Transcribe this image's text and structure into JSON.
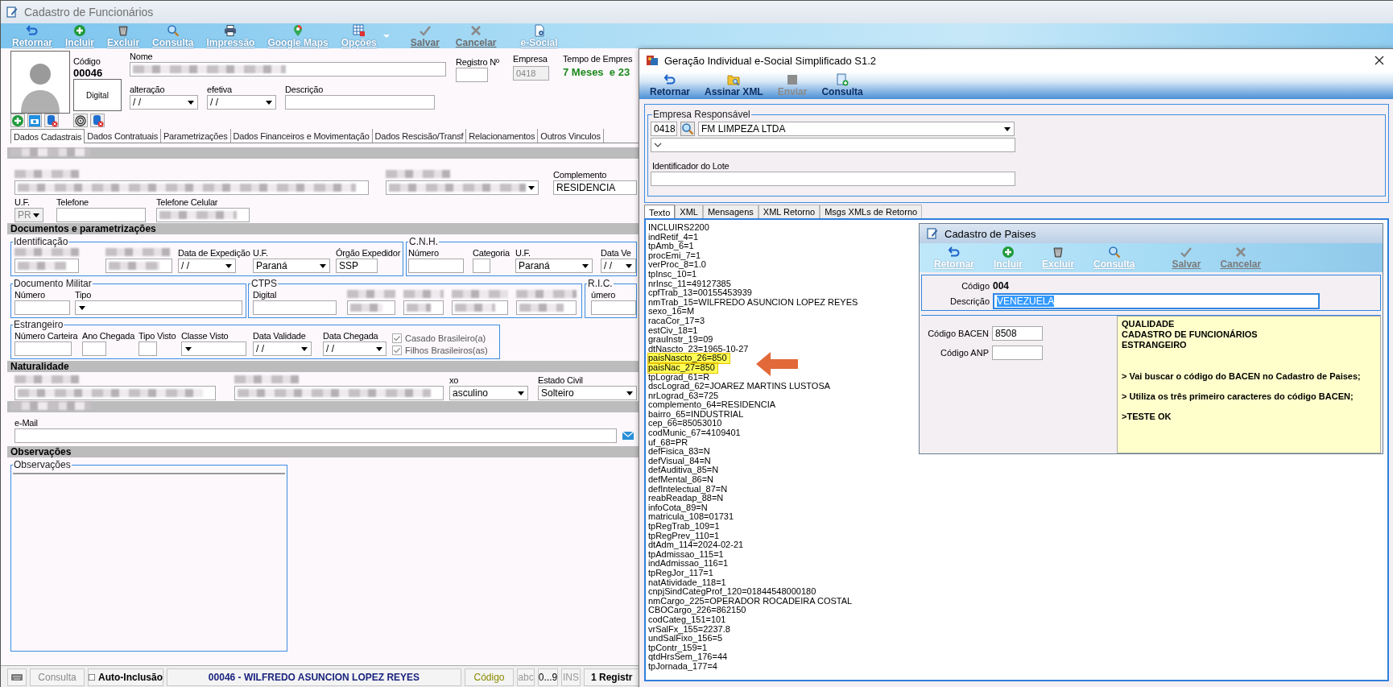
{
  "main_window": {
    "title": "Cadastro de Funcionários",
    "toolbar": [
      {
        "label": "Retornar",
        "disabled": false
      },
      {
        "label": "Incluir",
        "disabled": false
      },
      {
        "label": "Excluir",
        "disabled": false
      },
      {
        "label": "Consulta",
        "disabled": false
      },
      {
        "label": "Impressão",
        "disabled": false
      },
      {
        "label": "Google Maps",
        "disabled": false
      },
      {
        "label": "Opções",
        "disabled": false
      },
      {
        "label": "Salvar",
        "disabled": true
      },
      {
        "label": "Cancelar",
        "disabled": true
      },
      {
        "label": "e-Social",
        "disabled": false
      }
    ],
    "header": {
      "codigo_label": "Código",
      "codigo": "00046",
      "digital": "Digital",
      "nome_label": "Nome",
      "registro_label": "Registro Nº",
      "empresa_label": "Empresa",
      "empresa": "0418",
      "empresa_disabled": true,
      "tempo_label": "Tempo de Empres",
      "tempo": "7 Meses  e 23",
      "alteracao_label": "alteração",
      "alteracao": "/ /",
      "efetiva_label": "efetiva",
      "efetiva": "/ /",
      "descricao_label": "Descrição"
    },
    "tabs": [
      {
        "label": "Dados Cadastrais",
        "selected": true
      },
      {
        "label": "Dados Contratuais",
        "selected": false
      },
      {
        "label": "Parametrizações",
        "selected": false
      },
      {
        "label": "Dados Financeiros e Movimentação",
        "selected": false
      },
      {
        "label": "Dados Rescisão/Transf",
        "selected": false
      },
      {
        "label": "Relacionamentos",
        "selected": false
      },
      {
        "label": "Outros Vinculos",
        "selected": false
      }
    ],
    "blocks": [
      {
        "kind": "band"
      },
      {
        "kind": "row",
        "fields": [
          {
            "kind": "text",
            "redacted": true
          },
          {
            "kind": "combo",
            "redacted": true
          },
          {
            "kind": "text",
            "label": "Complemento",
            "value": "RESIDENCIA"
          }
        ]
      },
      {
        "kind": "row",
        "fields": [
          {
            "kind": "combo",
            "label": "U.F.",
            "value": "PR",
            "disabled": true
          },
          {
            "kind": "text",
            "label": "Telefone"
          },
          {
            "kind": "text",
            "label": "Telefone Celular",
            "redacted": true
          }
        ]
      },
      {
        "kind": "band",
        "title": "Documentos e parametrizações"
      },
      {
        "kind": "groups",
        "groups": [
          {
            "title": "Identificação",
            "fields": [
              {
                "kind": "text",
                "redacted": true
              },
              {
                "kind": "text",
                "redacted": true
              },
              {
                "kind": "combo",
                "label": "Data de Expedição",
                "value": "/ /"
              },
              {
                "kind": "combo",
                "label": "U.F.",
                "value": "Paraná"
              },
              {
                "kind": "text",
                "label": "Órgão Expedidor",
                "value": "SSP"
              }
            ]
          },
          {
            "title": "C.N.H.",
            "fields": [
              {
                "kind": "text",
                "label": "Número"
              },
              {
                "kind": "text",
                "label": "Categoria"
              },
              {
                "kind": "combo",
                "label": "U.F.",
                "value": "Paraná"
              },
              {
                "kind": "combo",
                "label": "Data Ve",
                "value": "/ /"
              }
            ]
          }
        ]
      },
      {
        "kind": "groups",
        "groups": [
          {
            "title": "Documento Militar",
            "fields": [
              {
                "kind": "text",
                "label": "Número"
              },
              {
                "kind": "combo",
                "label": "Tipo"
              }
            ]
          },
          {
            "title": "CTPS",
            "fields": [
              {
                "kind": "text",
                "label": "Digital"
              },
              {
                "kind": "text",
                "redacted": true
              },
              {
                "kind": "text",
                "redacted": true
              },
              {
                "kind": "text",
                "redacted": true
              },
              {
                "kind": "text",
                "redacted": true
              }
            ]
          },
          {
            "title": "R.I.C.",
            "fields": [
              {
                "kind": "text",
                "label": "úmero"
              }
            ]
          }
        ]
      },
      {
        "kind": "groups",
        "groups": [
          {
            "title": "Estrangeiro",
            "fields": [
              {
                "kind": "text",
                "label": "Número Carteira"
              },
              {
                "kind": "text",
                "label": "Ano Chegada"
              },
              {
                "kind": "text",
                "label": "Tipo Visto"
              },
              {
                "kind": "combo",
                "label": "Classe Visto"
              },
              {
                "kind": "combo",
                "label": "Data Validade",
                "value": "/ /"
              },
              {
                "kind": "combo",
                "label": "Data Chegada",
                "value": "/ /"
              },
              {
                "kind": "checklist",
                "disabled": true,
                "items": [
                  {
                    "label": "Casado Brasileiro(a)",
                    "checked": true
                  },
                  {
                    "label": "Filhos Brasileiros(as)",
                    "checked": true
                  }
                ]
              }
            ]
          }
        ]
      },
      {
        "kind": "band",
        "title": "Naturalidade"
      },
      {
        "kind": "row",
        "fields": [
          {
            "kind": "text",
            "redacted": true
          },
          {
            "kind": "text",
            "redacted": true
          },
          {
            "kind": "combo",
            "label": "xo",
            "value": "asculino"
          },
          {
            "kind": "combo",
            "label": "Estado Civil",
            "value": "Solteiro"
          }
        ]
      },
      {
        "kind": "band"
      },
      {
        "kind": "row",
        "fields": [
          {
            "kind": "email",
            "label": "e-Mail"
          }
        ]
      },
      {
        "kind": "band",
        "title": "Observações"
      },
      {
        "kind": "memo",
        "title": "Observações"
      }
    ],
    "status_bar": {
      "consulta": "Consulta",
      "auto_inclusao": "Auto-Inclusão",
      "auto_inclusao_checked": false,
      "record": "00046 - WILFREDO ASUNCION LOPEZ REYES",
      "sort_key": "Código",
      "abc": "abc",
      "digits": "0...9",
      "ins": "INS",
      "count": "1 Registr"
    }
  },
  "esocial_dialog": {
    "title": "Geração Individual e-Social Simplificado S1.2",
    "toolbar": [
      {
        "label": "Retornar",
        "disabled": false
      },
      {
        "label": "Assinar XML",
        "disabled": false
      },
      {
        "label": "Enviar",
        "disabled": true
      },
      {
        "label": "Consulta",
        "disabled": false
      }
    ],
    "group_title": "Empresa Responsável",
    "empresa_codigo": "0418",
    "empresa_nome": "FM LIMPEZA LTDA",
    "lote_label": "Identificador do Lote",
    "tabs": [
      {
        "label": "Texto",
        "selected": true
      },
      {
        "label": "XML",
        "selected": false
      },
      {
        "label": "Mensagens",
        "selected": false
      },
      {
        "label": "XML Retorno",
        "selected": false
      },
      {
        "label": "Msgs XMLs de Retorno",
        "selected": false
      }
    ],
    "text_lines": [
      {
        "text": "INCLUIRS2200",
        "highlighted": false
      },
      {
        "text": "indRetif_4=1",
        "highlighted": false
      },
      {
        "text": "tpAmb_6=1",
        "highlighted": false
      },
      {
        "text": "procEmi_7=1",
        "highlighted": false
      },
      {
        "text": "verProc_8=1.0",
        "highlighted": false
      },
      {
        "text": "tpInsc_10=1",
        "highlighted": false
      },
      {
        "text": "nrInsc_11=49127385",
        "highlighted": false
      },
      {
        "text": "cpfTrab_13=00155453939",
        "highlighted": false
      },
      {
        "text": "nmTrab_15=WILFREDO ASUNCION LOPEZ REYES",
        "highlighted": false
      },
      {
        "text": "sexo_16=M",
        "highlighted": false
      },
      {
        "text": "racaCor_17=3",
        "highlighted": false
      },
      {
        "text": "estCiv_18=1",
        "highlighted": false
      },
      {
        "text": "grauInstr_19=09",
        "highlighted": false
      },
      {
        "text": "dtNascto_23=1965-10-27",
        "highlighted": false
      },
      {
        "text": "paisNascto_26=850",
        "highlighted": true
      },
      {
        "text": "paisNac_27=850",
        "highlighted": true
      },
      {
        "text": "tpLograd_61=R",
        "highlighted": false
      },
      {
        "text": "dscLograd_62=JOAREZ MARTINS LUSTOSA",
        "highlighted": false
      },
      {
        "text": "nrLograd_63=725",
        "highlighted": false
      },
      {
        "text": "complemento_64=RESIDENCIA",
        "highlighted": false
      },
      {
        "text": "bairro_65=INDUSTRIAL",
        "highlighted": false
      },
      {
        "text": "cep_66=85053010",
        "highlighted": false
      },
      {
        "text": "codMunic_67=4109401",
        "highlighted": false
      },
      {
        "text": "uf_68=PR",
        "highlighted": false
      },
      {
        "text": "defFisica_83=N",
        "highlighted": false
      },
      {
        "text": "defVisual_84=N",
        "highlighted": false
      },
      {
        "text": "defAuditiva_85=N",
        "highlighted": false
      },
      {
        "text": "defMental_86=N",
        "highlighted": false
      },
      {
        "text": "defIntelectual_87=N",
        "highlighted": false
      },
      {
        "text": "reabReadap_88=N",
        "highlighted": false
      },
      {
        "text": "infoCota_89=N",
        "highlighted": false
      },
      {
        "text": "matricula_108=01731",
        "highlighted": false
      },
      {
        "text": "tpRegTrab_109=1",
        "highlighted": false
      },
      {
        "text": "tpRegPrev_110=1",
        "highlighted": false
      },
      {
        "text": "dtAdm_114=2024-02-21",
        "highlighted": false
      },
      {
        "text": "tpAdmissao_115=1",
        "highlighted": false
      },
      {
        "text": "indAdmissao_116=1",
        "highlighted": false
      },
      {
        "text": "tpRegJor_117=1",
        "highlighted": false
      },
      {
        "text": "natAtividade_118=1",
        "highlighted": false
      },
      {
        "text": "cnpjSindCategProf_120=01844548000180",
        "highlighted": false
      },
      {
        "text": "nmCargo_225=OPERADOR ROCADEIRA COSTAL",
        "highlighted": false
      },
      {
        "text": "CBOCargo_226=862150",
        "highlighted": false
      },
      {
        "text": "codCateg_151=101",
        "highlighted": false
      },
      {
        "text": "vrSalFx_155=2237.8",
        "highlighted": false
      },
      {
        "text": "undSalFixo_156=5",
        "highlighted": false
      },
      {
        "text": "tpContr_159=1",
        "highlighted": false
      },
      {
        "text": "qtdHrsSem_176=44",
        "highlighted": false
      },
      {
        "text": "tpJornada_177=4",
        "highlighted": false
      }
    ]
  },
  "paises_window": {
    "title": "Cadastro de Paises",
    "toolbar": [
      {
        "label": "Retornar",
        "disabled": false
      },
      {
        "label": "Incluir",
        "disabled": false
      },
      {
        "label": "Excluir",
        "disabled": false
      },
      {
        "label": "Consulta",
        "disabled": false
      },
      {
        "label": "Salvar",
        "disabled": true
      },
      {
        "label": "Cancelar",
        "disabled": true
      }
    ],
    "codigo_label": "Código",
    "codigo": "004",
    "descricao_label": "Descrição",
    "descricao": "VENEZUELA",
    "descricao_selected": true,
    "bacen_label": "Código BACEN",
    "bacen": "8508",
    "anp_label": "Código ANP",
    "note": {
      "heading": [
        "QUALIDADE",
        "CADASTRO DE FUNCIONÁRIOS",
        "ESTRANGEIRO"
      ],
      "items": [
        "> Vai buscar o código do BACEN no Cadastro de Paises;",
        "> Utiliza os três primeiro caracteres do código BACEN;",
        ">TESTE OK"
      ]
    }
  }
}
